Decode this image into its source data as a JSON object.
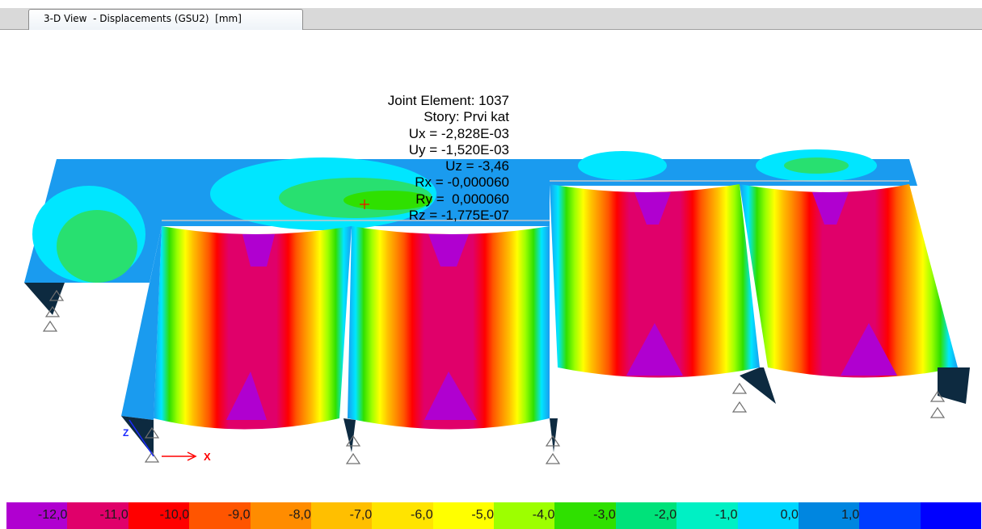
{
  "tab": {
    "title": "3-D View  - Displacements (GSU2)  [mm]"
  },
  "info": {
    "lines": [
      "Joint Element: 1037",
      "Story: Prvi kat",
      "Ux = -2,828E-03",
      "Uy = -1,520E-03",
      "Uz = -3,46",
      "Rx = -0,000060",
      "Ry =  0,000060",
      "Rz = -1,775E-07"
    ]
  },
  "axis": {
    "x_label": "X",
    "z_label": "Z"
  },
  "legend": {
    "colors": [
      "#b000d0",
      "#e0006a",
      "#ff0000",
      "#ff5500",
      "#ff8c00",
      "#ffbf00",
      "#ffe400",
      "#ffff00",
      "#9dff00",
      "#2fe000",
      "#00e27a",
      "#00f0c4",
      "#00d7ff",
      "#0086e0",
      "#003cff",
      "#0000ff"
    ],
    "labels": [
      "-12,0",
      "-11,0",
      "-10,0",
      "-9,0",
      "-8,0",
      "-7,0",
      "-6,0",
      "-5,0",
      "-4,0",
      "-3,0",
      "-2,0",
      "-1,0",
      "0,0",
      "1,0",
      ""
    ]
  },
  "colors": {
    "slab": "#1a9bef",
    "cyan": "#00e6ff",
    "green": "#28e070",
    "magenta": "#b000d0",
    "crimson": "#e0006a",
    "dark": "#0d2a40",
    "cursor": "#ff0000"
  }
}
